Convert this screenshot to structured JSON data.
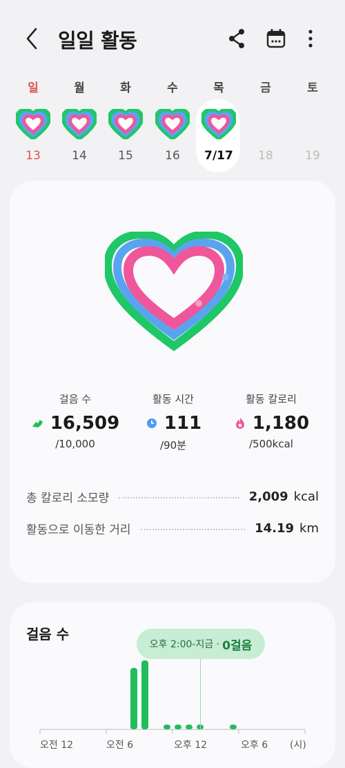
{
  "header": {
    "title": "일일 활동",
    "icons": [
      "back-arrow-icon",
      "share-icon",
      "calendar-icon",
      "more-vertical-icon"
    ]
  },
  "week": [
    {
      "name": "일",
      "num": "13"
    },
    {
      "name": "월",
      "num": "14"
    },
    {
      "name": "화",
      "num": "15"
    },
    {
      "name": "수",
      "num": "16"
    },
    {
      "name": "목",
      "num": "7/17"
    },
    {
      "name": "금",
      "num": "18"
    },
    {
      "name": "토",
      "num": "19"
    }
  ],
  "summary": {
    "steps": {
      "label": "걸음 수",
      "value": "16,509",
      "goal": "/10,000",
      "icon": "shoe-icon",
      "color": "#1fbe5b"
    },
    "active_time": {
      "label": "활동 시간",
      "value": "111",
      "goal": "/90분",
      "icon": "clock-icon",
      "color": "#4c9ef0"
    },
    "active_cal": {
      "label": "활동 칼로리",
      "value": "1,180",
      "goal": "/500kcal",
      "icon": "flame-icon",
      "color": "#f0569a"
    }
  },
  "details": [
    {
      "label": "총 칼로리 소모량",
      "value": "2,009",
      "unit": "kcal"
    },
    {
      "label": "활동으로 이동한 거리",
      "value": "14.19",
      "unit": "km"
    }
  ],
  "steps_chart": {
    "title": "걸음 수",
    "tooltip_time": "오후 2:00-지금 ·",
    "tooltip_value": "0걸음",
    "x_labels": [
      "오전 12",
      "오전 6",
      "오후 12",
      "오후 6",
      "(시)"
    ]
  },
  "chart_data": {
    "type": "bar",
    "x": [
      0,
      1,
      2,
      3,
      4,
      5,
      6,
      7,
      8,
      9,
      10,
      11,
      12,
      13,
      14,
      15,
      16,
      17,
      18,
      19,
      20,
      21,
      22,
      23
    ],
    "values": [
      0,
      0,
      0,
      0,
      0,
      0,
      0,
      0,
      1.0,
      1.12,
      0,
      0.04,
      0.04,
      0.04,
      0.04,
      0,
      0,
      0.04,
      0,
      0,
      0,
      0,
      0,
      0
    ],
    "title": "걸음 수",
    "x_tick_labels": [
      "오전 12",
      "오전 6",
      "오후 12",
      "오후 6"
    ],
    "xlabel": "(시)",
    "color": "#1fbe5b"
  },
  "colors": {
    "green": "#1fc766",
    "blue": "#5aa4ef",
    "pink": "#f0569a",
    "accent_text": "#1c7d3e"
  }
}
